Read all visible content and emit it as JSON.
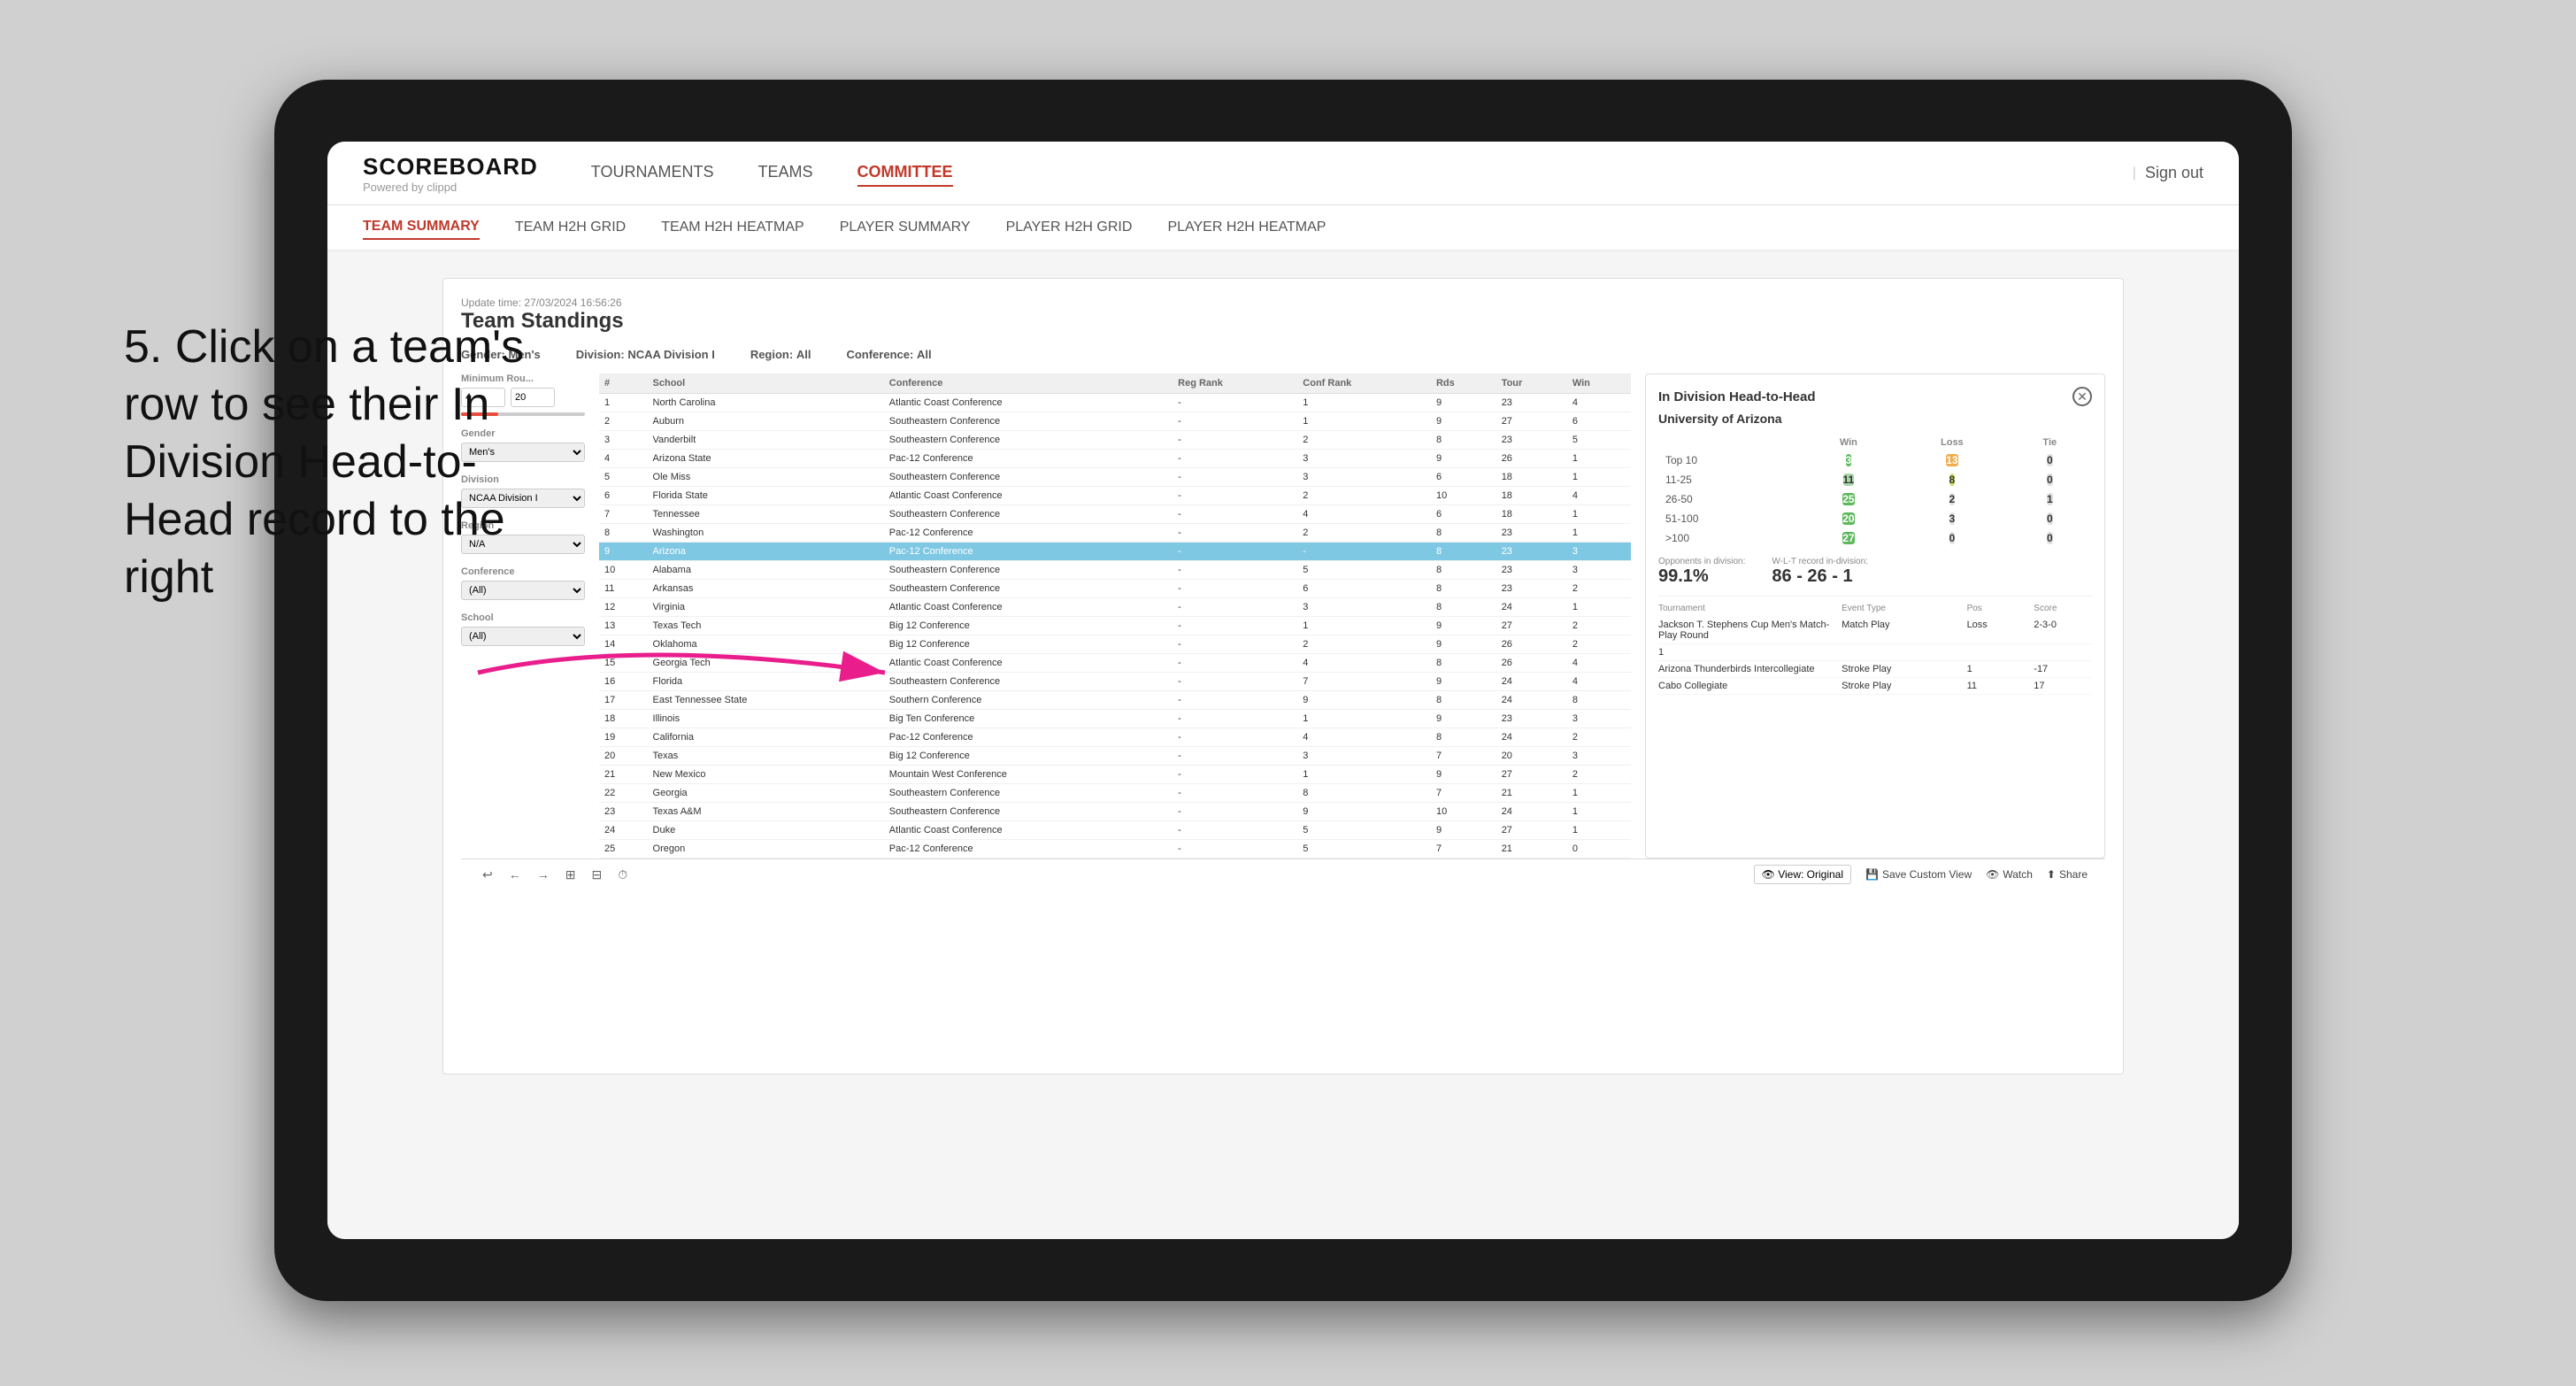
{
  "annotation": {
    "text": "5. Click on a team's row to see their In Division Head-to-Head record to the right"
  },
  "nav": {
    "logo": "SCOREBOARD",
    "logo_sub": "Powered by clippd",
    "items": [
      "TOURNAMENTS",
      "TEAMS",
      "COMMITTEE"
    ],
    "active_item": "COMMITTEE",
    "sign_out": "Sign out"
  },
  "sub_nav": {
    "items": [
      "TEAM SUMMARY",
      "TEAM H2H GRID",
      "TEAM H2H HEATMAP",
      "PLAYER SUMMARY",
      "PLAYER H2H GRID",
      "PLAYER H2H HEATMAP"
    ],
    "active_item": "PLAYER SUMMARY"
  },
  "panel": {
    "update_time_label": "Update time:",
    "update_time": "27/03/2024 16:56:26",
    "title": "Team Standings",
    "filters": {
      "gender_label": "Gender:",
      "gender": "Men's",
      "division_label": "Division:",
      "division": "NCAA Division I",
      "region_label": "Region:",
      "region": "All",
      "conference_label": "Conference:",
      "conference": "All"
    },
    "left_filters": {
      "min_rounds_label": "Minimum Rou...",
      "min_val": "4",
      "max_val": "20",
      "gender_label": "Gender",
      "gender_val": "Men's",
      "division_label": "Division",
      "division_val": "NCAA Division I",
      "region_label": "Region",
      "region_val": "N/A",
      "conference_label": "Conference",
      "conference_val": "(All)",
      "school_label": "School",
      "school_val": "(All)"
    },
    "table": {
      "headers": [
        "#",
        "School",
        "Conference",
        "Reg Rank",
        "Conf Rank",
        "Rds",
        "Tour",
        "Win"
      ],
      "rows": [
        {
          "rank": "1",
          "school": "North Carolina",
          "conference": "Atlantic Coast Conference",
          "reg_rank": "-",
          "conf_rank": "1",
          "rds": "9",
          "tour": "23",
          "win": "4"
        },
        {
          "rank": "2",
          "school": "Auburn",
          "conference": "Southeastern Conference",
          "reg_rank": "-",
          "conf_rank": "1",
          "rds": "9",
          "tour": "27",
          "win": "6"
        },
        {
          "rank": "3",
          "school": "Vanderbilt",
          "conference": "Southeastern Conference",
          "reg_rank": "-",
          "conf_rank": "2",
          "rds": "8",
          "tour": "23",
          "win": "5"
        },
        {
          "rank": "4",
          "school": "Arizona State",
          "conference": "Pac-12 Conference",
          "reg_rank": "-",
          "conf_rank": "3",
          "rds": "9",
          "tour": "26",
          "win": "1"
        },
        {
          "rank": "5",
          "school": "Ole Miss",
          "conference": "Southeastern Conference",
          "reg_rank": "-",
          "conf_rank": "3",
          "rds": "6",
          "tour": "18",
          "win": "1"
        },
        {
          "rank": "6",
          "school": "Florida State",
          "conference": "Atlantic Coast Conference",
          "reg_rank": "-",
          "conf_rank": "2",
          "rds": "10",
          "tour": "18",
          "win": "4"
        },
        {
          "rank": "7",
          "school": "Tennessee",
          "conference": "Southeastern Conference",
          "reg_rank": "-",
          "conf_rank": "4",
          "rds": "6",
          "tour": "18",
          "win": "1"
        },
        {
          "rank": "8",
          "school": "Washington",
          "conference": "Pac-12 Conference",
          "reg_rank": "-",
          "conf_rank": "2",
          "rds": "8",
          "tour": "23",
          "win": "1"
        },
        {
          "rank": "9",
          "school": "Arizona",
          "conference": "Pac-12 Conference",
          "reg_rank": "-",
          "conf_rank": "-",
          "rds": "8",
          "tour": "23",
          "win": "3",
          "highlighted": true
        },
        {
          "rank": "10",
          "school": "Alabama",
          "conference": "Southeastern Conference",
          "reg_rank": "-",
          "conf_rank": "5",
          "rds": "8",
          "tour": "23",
          "win": "3"
        },
        {
          "rank": "11",
          "school": "Arkansas",
          "conference": "Southeastern Conference",
          "reg_rank": "-",
          "conf_rank": "6",
          "rds": "8",
          "tour": "23",
          "win": "2"
        },
        {
          "rank": "12",
          "school": "Virginia",
          "conference": "Atlantic Coast Conference",
          "reg_rank": "-",
          "conf_rank": "3",
          "rds": "8",
          "tour": "24",
          "win": "1"
        },
        {
          "rank": "13",
          "school": "Texas Tech",
          "conference": "Big 12 Conference",
          "reg_rank": "-",
          "conf_rank": "1",
          "rds": "9",
          "tour": "27",
          "win": "2"
        },
        {
          "rank": "14",
          "school": "Oklahoma",
          "conference": "Big 12 Conference",
          "reg_rank": "-",
          "conf_rank": "2",
          "rds": "9",
          "tour": "26",
          "win": "2"
        },
        {
          "rank": "15",
          "school": "Georgia Tech",
          "conference": "Atlantic Coast Conference",
          "reg_rank": "-",
          "conf_rank": "4",
          "rds": "8",
          "tour": "26",
          "win": "4"
        },
        {
          "rank": "16",
          "school": "Florida",
          "conference": "Southeastern Conference",
          "reg_rank": "-",
          "conf_rank": "7",
          "rds": "9",
          "tour": "24",
          "win": "4"
        },
        {
          "rank": "17",
          "school": "East Tennessee State",
          "conference": "Southern Conference",
          "reg_rank": "-",
          "conf_rank": "9",
          "rds": "8",
          "tour": "24",
          "win": "8"
        },
        {
          "rank": "18",
          "school": "Illinois",
          "conference": "Big Ten Conference",
          "reg_rank": "-",
          "conf_rank": "1",
          "rds": "9",
          "tour": "23",
          "win": "3"
        },
        {
          "rank": "19",
          "school": "California",
          "conference": "Pac-12 Conference",
          "reg_rank": "-",
          "conf_rank": "4",
          "rds": "8",
          "tour": "24",
          "win": "2"
        },
        {
          "rank": "20",
          "school": "Texas",
          "conference": "Big 12 Conference",
          "reg_rank": "-",
          "conf_rank": "3",
          "rds": "7",
          "tour": "20",
          "win": "3"
        },
        {
          "rank": "21",
          "school": "New Mexico",
          "conference": "Mountain West Conference",
          "reg_rank": "-",
          "conf_rank": "1",
          "rds": "9",
          "tour": "27",
          "win": "2"
        },
        {
          "rank": "22",
          "school": "Georgia",
          "conference": "Southeastern Conference",
          "reg_rank": "-",
          "conf_rank": "8",
          "rds": "7",
          "tour": "21",
          "win": "1"
        },
        {
          "rank": "23",
          "school": "Texas A&M",
          "conference": "Southeastern Conference",
          "reg_rank": "-",
          "conf_rank": "9",
          "rds": "10",
          "tour": "24",
          "win": "1"
        },
        {
          "rank": "24",
          "school": "Duke",
          "conference": "Atlantic Coast Conference",
          "reg_rank": "-",
          "conf_rank": "5",
          "rds": "9",
          "tour": "27",
          "win": "1"
        },
        {
          "rank": "25",
          "school": "Oregon",
          "conference": "Pac-12 Conference",
          "reg_rank": "-",
          "conf_rank": "5",
          "rds": "7",
          "tour": "21",
          "win": "0"
        }
      ]
    }
  },
  "h2h": {
    "title": "In Division Head-to-Head",
    "team": "University of Arizona",
    "table_headers": [
      "",
      "Win",
      "Loss",
      "Tie"
    ],
    "rows": [
      {
        "label": "Top 10",
        "win": "3",
        "loss": "13",
        "tie": "0",
        "win_class": "cell-green",
        "loss_class": "cell-orange",
        "tie_class": "cell-gray"
      },
      {
        "label": "11-25",
        "win": "11",
        "loss": "8",
        "tie": "0",
        "win_class": "cell-light-green",
        "loss_class": "cell-yellow",
        "tie_class": "cell-gray"
      },
      {
        "label": "26-50",
        "win": "25",
        "loss": "2",
        "tie": "1",
        "win_class": "cell-green",
        "loss_class": "cell-gray",
        "tie_class": "cell-gray"
      },
      {
        "label": "51-100",
        "win": "20",
        "loss": "3",
        "tie": "0",
        "win_class": "cell-green",
        "loss_class": "cell-gray",
        "tie_class": "cell-gray"
      },
      {
        "label": ">100",
        "win": "27",
        "loss": "0",
        "tie": "0",
        "win_class": "cell-green",
        "loss_class": "cell-gray",
        "tie_class": "cell-gray"
      }
    ],
    "opponents_label": "Opponents in division:",
    "opponents_val": "99.1%",
    "wl_label": "W-L-T record in-division:",
    "wl_val": "86 - 26 - 1",
    "tournament_label": "Tournament",
    "event_type_label": "Event Type",
    "pos_label": "Pos",
    "score_label": "Score",
    "tournaments": [
      {
        "name": "Jackson T. Stephens Cup Men's Match-Play Round",
        "type": "Match Play",
        "result": "Loss",
        "score": "2-3-0"
      },
      {
        "name": "1",
        "type": "",
        "result": "",
        "score": ""
      },
      {
        "name": "Arizona Thunderbirds Intercollegiate",
        "type": "Stroke Play",
        "result": "1",
        "score": "-17"
      },
      {
        "name": "",
        "type": "",
        "result": "",
        "score": ""
      },
      {
        "name": "Cabo Collegiate",
        "type": "Stroke Play",
        "result": "11",
        "score": "17"
      }
    ]
  },
  "toolbar": {
    "view_original": "View: Original",
    "save_custom": "Save Custom View",
    "watch": "Watch",
    "share": "Share"
  }
}
